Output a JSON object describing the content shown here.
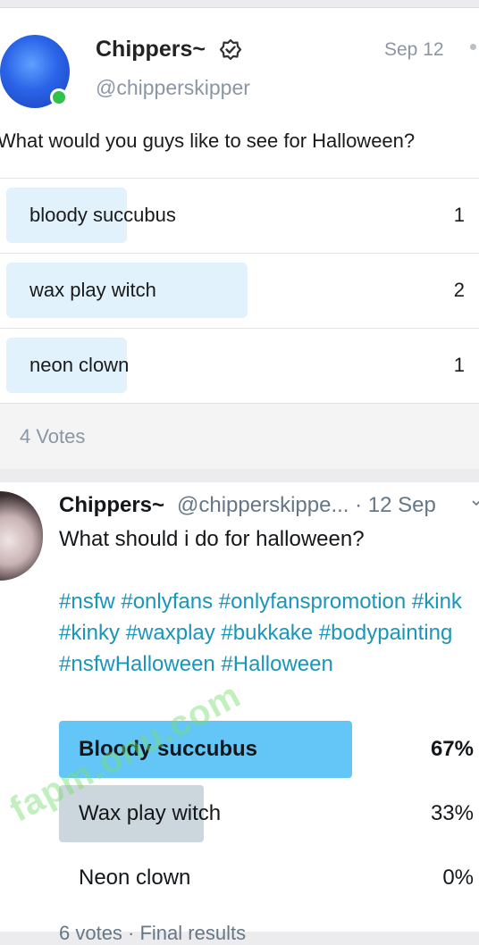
{
  "post1": {
    "name": "Chippers~",
    "handle": "@chipperskipper",
    "date": "Sep 12",
    "question": "What would you guys like to see for Halloween?",
    "options": [
      {
        "label": "bloody succubus",
        "count": "1",
        "fraction": 0.25
      },
      {
        "label": "wax play witch",
        "count": "2",
        "fraction": 0.5
      },
      {
        "label": "neon clown",
        "count": "1",
        "fraction": 0.25
      }
    ],
    "votes": "4 Votes",
    "colors": {
      "fill": "#e1f2fc",
      "online": "#2fc04d"
    }
  },
  "post2": {
    "name": "Chippers~",
    "meta": "@chipperskippe... · 12 Sep",
    "question": "What should i do for halloween?",
    "hashtags": "#nsfw #onlyfans #onlyfanspromotion #kink #kinky #waxplay #bukkake #bodypainting #nsfwHalloween #Halloween",
    "options": [
      {
        "label": "Bloody succubus",
        "pct": "67%",
        "fraction": 0.67,
        "winner": true
      },
      {
        "label": "Wax play witch",
        "pct": "33%",
        "fraction": 0.33,
        "winner": false
      },
      {
        "label": "Neon clown",
        "pct": "0%",
        "fraction": 0,
        "winner": false
      }
    ],
    "footer": "6 votes · Final results",
    "colors": {
      "winner": "#63c6f7",
      "other": "#ccd6dd",
      "hashtag": "#1b95b8"
    }
  },
  "watermark": "fapm.onu.com"
}
